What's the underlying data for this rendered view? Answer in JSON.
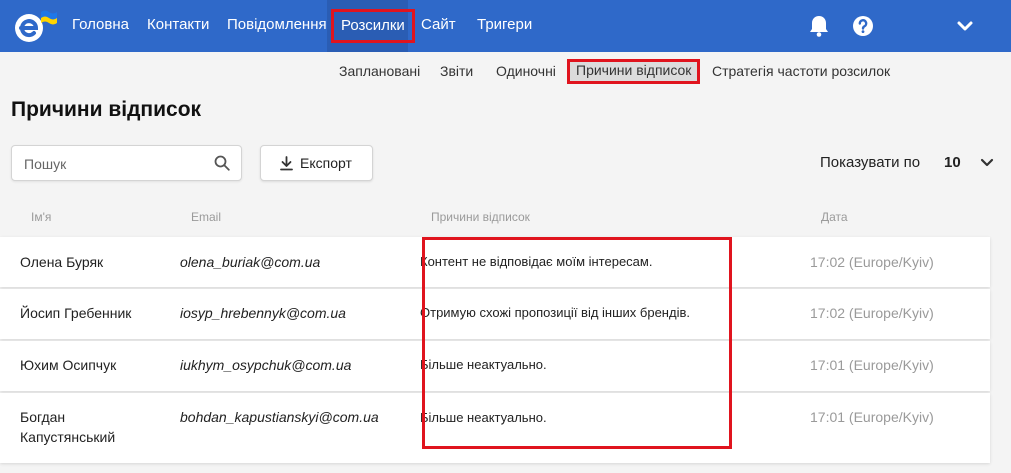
{
  "nav": {
    "items": [
      {
        "label": "Головна"
      },
      {
        "label": "Контакти"
      },
      {
        "label": "Повідомлення"
      },
      {
        "label": "Розсилки"
      },
      {
        "label": "Сайт"
      },
      {
        "label": "Тригери"
      }
    ],
    "active": "Розсилки",
    "accent_color": "#2f69c9",
    "highlight_color": "#e0141e",
    "icons": [
      "bell-icon",
      "help-icon",
      "chevron-down-icon"
    ]
  },
  "subnav": {
    "items": [
      {
        "label": "Заплановані"
      },
      {
        "label": "Звіти"
      },
      {
        "label": "Одиночні"
      },
      {
        "label": "Причини відписок"
      },
      {
        "label": "Стратегія частоти розсилок"
      }
    ],
    "active": "Причини відписок"
  },
  "page": {
    "title": "Причини відписок"
  },
  "search": {
    "placeholder": "Пошук",
    "value": ""
  },
  "toolbar": {
    "export_label": "Експорт"
  },
  "pagination": {
    "per_page_label": "Показувати по",
    "per_page_value": "10"
  },
  "table": {
    "headers": {
      "name": "Ім'я",
      "email": "Email",
      "reason": "Причини відписок",
      "date": "Дата"
    },
    "rows": [
      {
        "name": "Олена Буряк",
        "email": "olena_buriak@com.ua",
        "reason": "Контент не відповідає моїм інтересам.",
        "date": "17:02 (Europe/Kyiv)"
      },
      {
        "name": "Йосип Гребенник",
        "email": "iosyp_hrebennyk@com.ua",
        "reason": "Отримую схожі пропозиції від інших брендів.",
        "date": "17:02 (Europe/Kyiv)"
      },
      {
        "name": "Юхим Осипчук",
        "email": "iukhym_osypchuk@com.ua",
        "reason": "Більше неактуально.",
        "date": "17:01 (Europe/Kyiv)"
      },
      {
        "name": "Богдан Капустянський",
        "email": "bohdan_kapustianskyi@com.ua",
        "reason": "Більше неактуально.",
        "date": "17:01 (Europe/Kyiv)"
      }
    ]
  }
}
